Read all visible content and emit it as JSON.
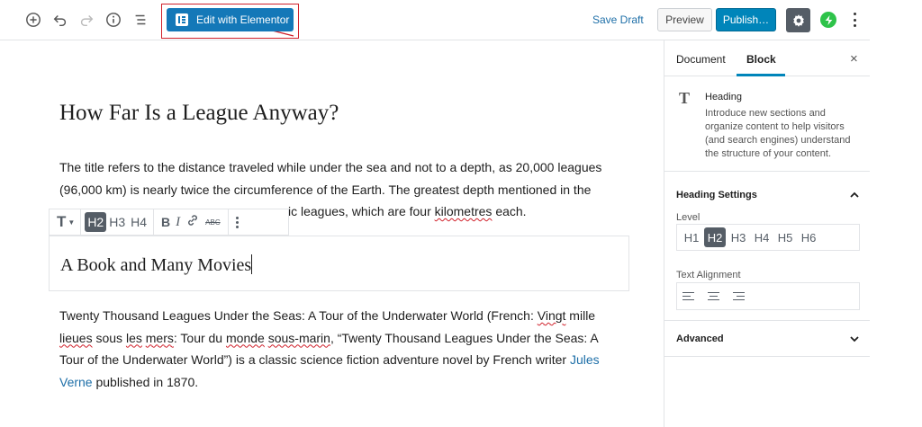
{
  "toolbar": {
    "elementor_label": "Edit with Elementor",
    "save_draft": "Save Draft",
    "preview": "Preview",
    "publish": "Publish…",
    "icons": [
      "add-block-icon",
      "undo-icon",
      "redo-icon",
      "info-icon",
      "outline-icon",
      "gear-icon",
      "bolt-icon",
      "more-options-icon"
    ]
  },
  "post": {
    "title": "How Far Is a League Anyway?",
    "paragraph1": "The title refers to the distance traveled while under the sea and not to a depth, as 20,000 leagues (96,000 km) is nearly twice the circumference of the Earth. The greatest depth mentioned in the",
    "paragraph1_tail_a": "ic leagues, which are four ",
    "paragraph1_tail_b": "kilometres",
    "paragraph1_tail_c": " each.",
    "heading_block": "A Book and Many Movies",
    "paragraph2": {
      "p1": "Twenty Thousand Leagues Under the Seas: A Tour of the Underwater World (French: ",
      "w1": "Vingt",
      "p2": " mille ",
      "w2": "lieues",
      "p3": " sous ",
      "w3": "les",
      "p4": " ",
      "w4": "mers",
      "p5": ": Tour du ",
      "w5": "monde",
      "p6": " ",
      "w6": "sous-marin",
      "p7": ", “Twenty Thousand Leagues Under the Seas: A Tour of the Underwater World”) is a classic science fiction adventure novel by French writer ",
      "link": "Jules Verne",
      "p8": " published in 1870."
    }
  },
  "block_toolbar": {
    "type_label": "T",
    "levels": [
      "H2",
      "H3",
      "H4"
    ],
    "active_level": "H2",
    "bold": "B",
    "italic": "I",
    "strike": "ABC"
  },
  "sidebar": {
    "tabs": [
      "Document",
      "Block"
    ],
    "active_tab": "Block",
    "close": "×",
    "block_card": {
      "icon": "T",
      "title": "Heading",
      "description": "Introduce new sections and organize content to help visitors (and search engines) understand the structure of your content."
    },
    "heading_settings": {
      "title": "Heading Settings",
      "level_label": "Level",
      "levels": [
        "H1",
        "H2",
        "H3",
        "H4",
        "H5",
        "H6"
      ],
      "active_level": "H2",
      "alignment_label": "Text Alignment"
    },
    "advanced": {
      "title": "Advanced"
    }
  },
  "colors": {
    "accent": "#0085ba",
    "elementor": "#1478b8",
    "link": "#1e6fa8",
    "highlight_box": "#d0202a",
    "bolt": "#2ec34a"
  }
}
